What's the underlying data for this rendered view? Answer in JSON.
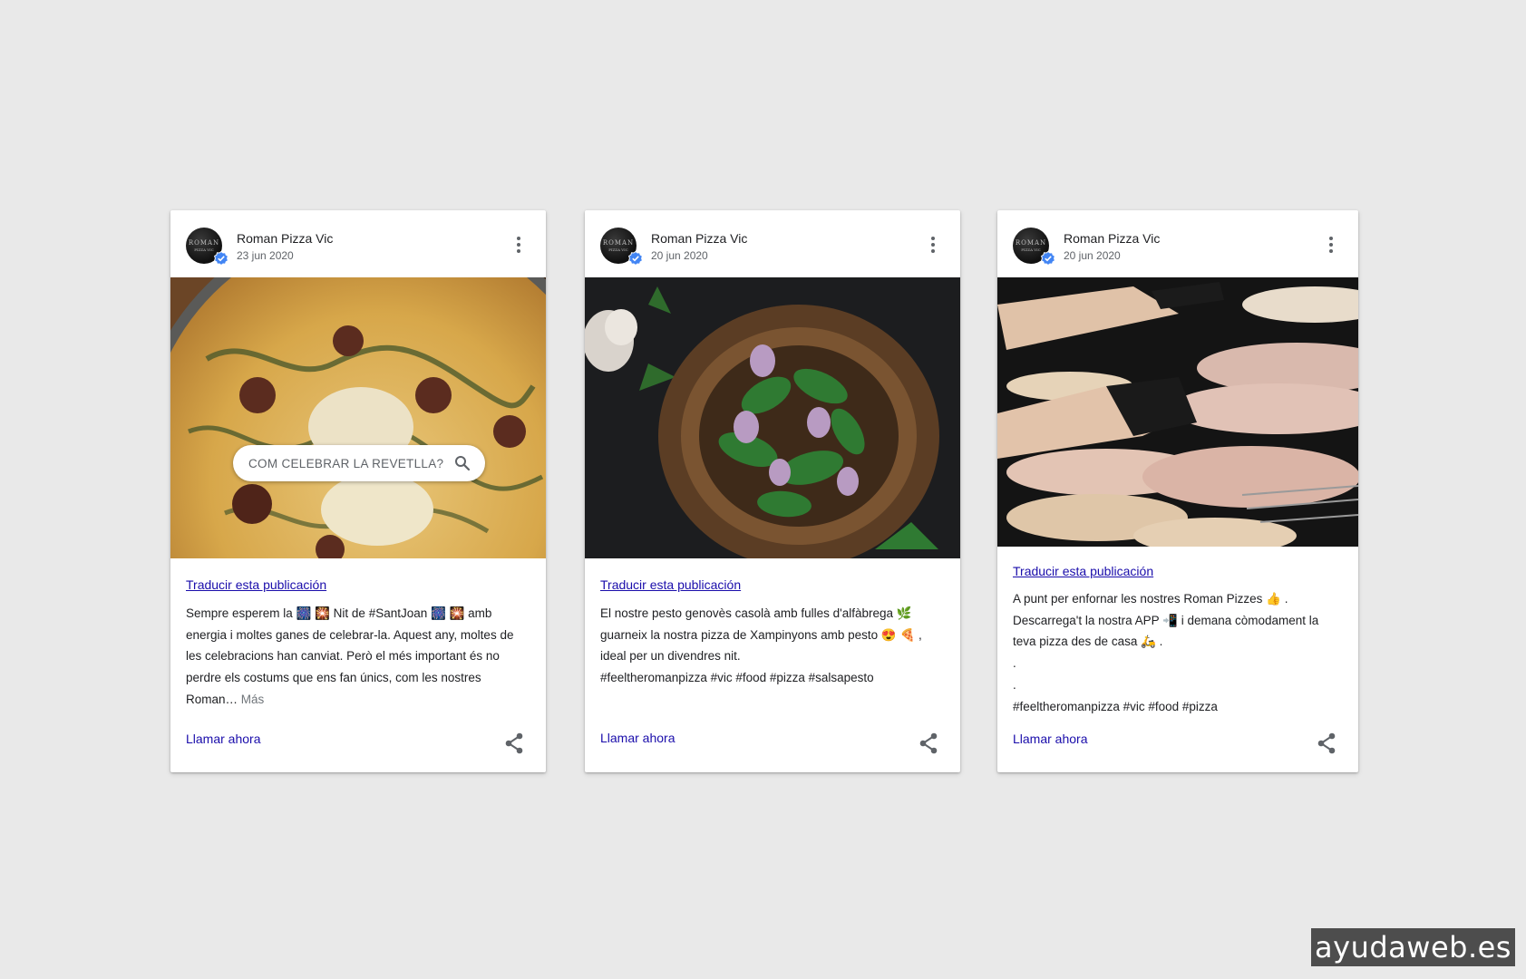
{
  "posts": [
    {
      "business_name": "Roman Pizza Vic",
      "date": "23 jun 2020",
      "avatar_text": "ROMAN",
      "avatar_sub": "PIZZA VIC",
      "image_overlay_text": "COM CELEBRAR LA REVETLLA?",
      "translate_link": "Traducir esta publicación",
      "text_lines": [
        "Sempre esperem la 🎆 🎇 Nit de #SantJoan 🎆 🎇  amb",
        "energia i moltes ganes de celebrar-la. Aquest any, moltes de",
        "les celebracions han canviat. Però el més important és no",
        "perdre els costums que ens fan únics, com les nostres",
        "Roman…"
      ],
      "more_label": "Más",
      "call_label": "Llamar ahora"
    },
    {
      "business_name": "Roman Pizza Vic",
      "date": "20 jun 2020",
      "avatar_text": "ROMAN",
      "avatar_sub": "PIZZA VIC",
      "translate_link": "Traducir esta publicación",
      "text_lines": [
        "El nostre pesto genovès casolà amb fulles d'alfàbrega 🌿",
        "guarneix la nostra pizza de Xampinyons amb pesto 😍 🍕 ,",
        "ideal per un divendres nit.",
        " ",
        "#feeltheromanpizza #vic #food #pizza #salsapesto"
      ],
      "call_label": "Llamar ahora"
    },
    {
      "business_name": "Roman Pizza Vic",
      "date": "20 jun 2020",
      "avatar_text": "ROMAN",
      "avatar_sub": "PIZZA VIC",
      "translate_link": "Traducir esta publicación",
      "text_lines": [
        "A punt per enfornar les nostres Roman Pizzes 👍 .",
        "Descarrega't la nostra APP 📲  i demana còmodament la",
        "teva pizza des de casa 🛵 .",
        ".",
        ".",
        "#feeltheromanpizza #vic #food #pizza"
      ],
      "call_label": "Llamar ahora"
    }
  ],
  "watermark": "ayudaweb.es",
  "icons": {
    "verified": "verified-badge-icon",
    "more": "more-vert-icon",
    "share": "share-icon",
    "search": "search-icon"
  },
  "colors": {
    "background": "#e9e9e9",
    "link": "#1a0dab",
    "verified": "#4285f4"
  }
}
